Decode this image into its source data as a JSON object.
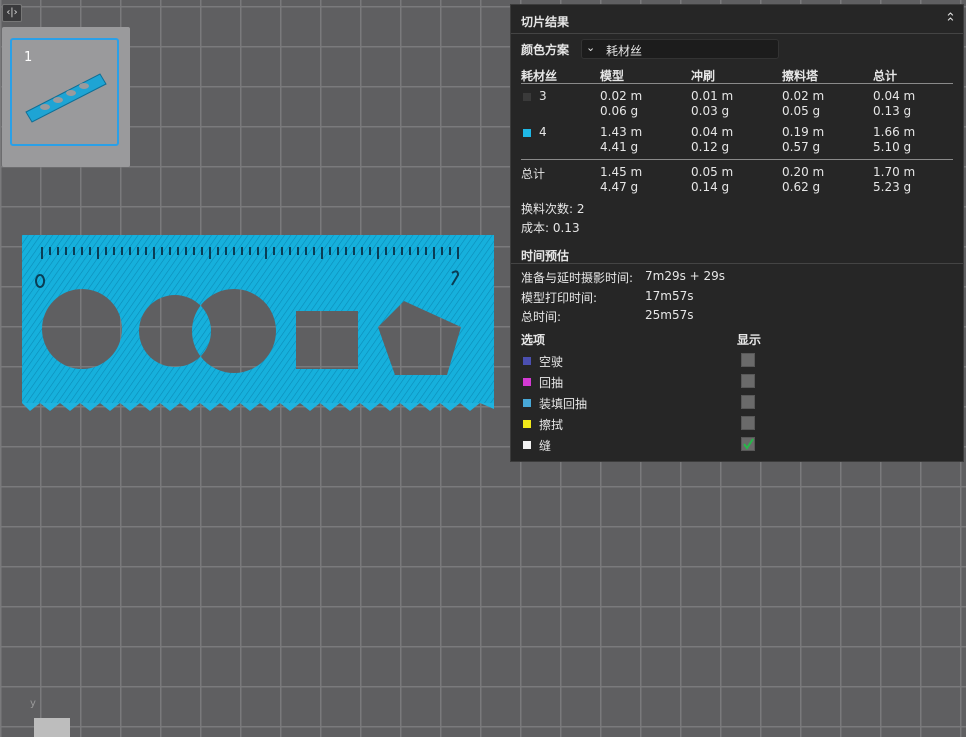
{
  "thumbnail": {
    "plate_number": "1"
  },
  "toggle_icon": "collapse-expand-icon",
  "panel": {
    "title": "切片结果",
    "collapse_icon": "double-chevron-up-icon",
    "scheme_label": "颜色方案",
    "scheme_value": "耗材丝",
    "headers": {
      "filament": "耗材丝",
      "model": "模型",
      "flush": "冲刷",
      "tower": "擦料塔",
      "total": "总计"
    },
    "rows": [
      {
        "id": "3",
        "color": "#3a3a3a",
        "model_m": "0.02 m",
        "model_g": "0.06 g",
        "flush_m": "0.01 m",
        "flush_g": "0.03 g",
        "tower_m": "0.02 m",
        "tower_g": "0.05 g",
        "total_m": "0.04 m",
        "total_g": "0.13 g"
      },
      {
        "id": "4",
        "color": "#1fb8e6",
        "model_m": "1.43 m",
        "model_g": "4.41 g",
        "flush_m": "0.04 m",
        "flush_g": "0.12 g",
        "tower_m": "0.19 m",
        "tower_g": "0.57 g",
        "total_m": "1.66 m",
        "total_g": "5.10 g"
      }
    ],
    "summary": {
      "label": "总计",
      "model_m": "1.45 m",
      "model_g": "4.47 g",
      "flush_m": "0.05 m",
      "flush_g": "0.14 g",
      "tower_m": "0.20 m",
      "tower_g": "0.62 g",
      "total_m": "1.70 m",
      "total_g": "5.23 g"
    },
    "swaps": "换料次数:  2",
    "cost": "成本:  0.13",
    "time_title": "时间预估",
    "prep_label": "准备与延时摄影时间:",
    "prep_value": "7m29s + 29s",
    "print_label": "模型打印时间:",
    "print_value": "17m57s",
    "total_time_label": "总时间:",
    "total_time_value": "25m57s",
    "options_label": "选项",
    "display_label": "显示",
    "options": [
      {
        "label": "空驶",
        "color": "#4b4fb0",
        "checked": false
      },
      {
        "label": "回抽",
        "color": "#d43ad4",
        "checked": false
      },
      {
        "label": "装填回抽",
        "color": "#48a8d8",
        "checked": false
      },
      {
        "label": "擦拭",
        "color": "#f0e81a",
        "checked": false
      },
      {
        "label": "缝",
        "color": "#f2f2f2",
        "checked": true
      }
    ]
  },
  "axis_label": "y"
}
